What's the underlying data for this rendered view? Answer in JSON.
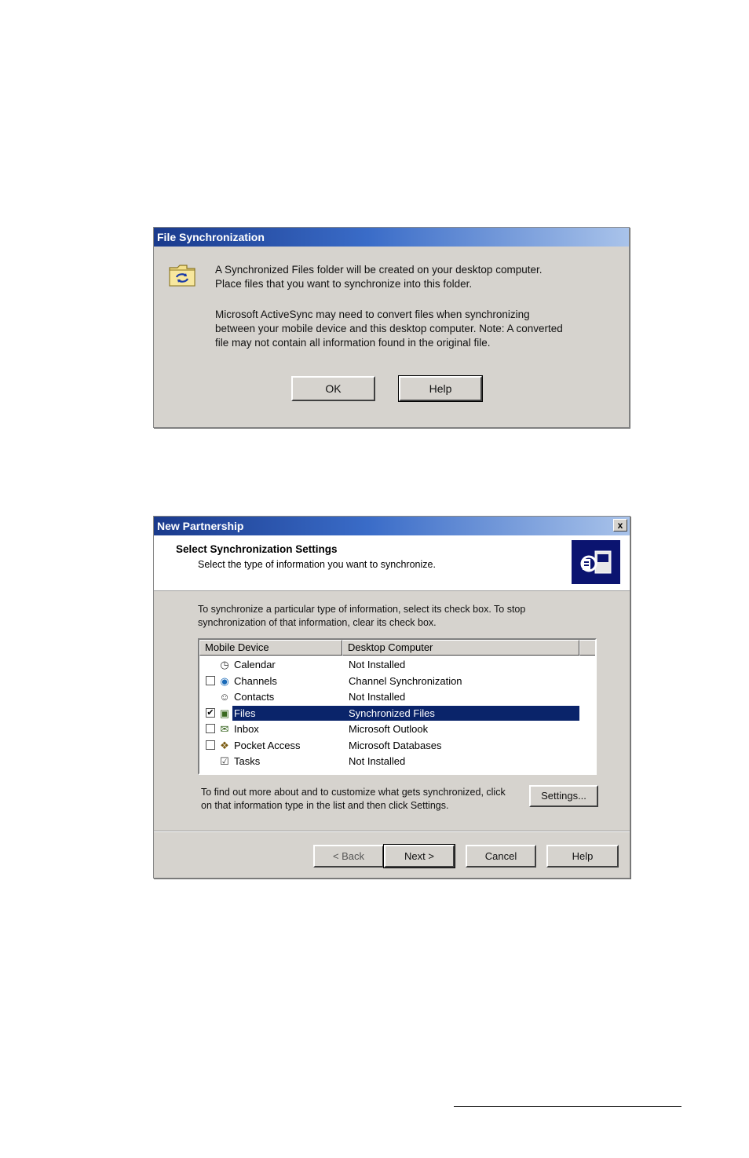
{
  "file_sync_dialog": {
    "title": "File Synchronization",
    "message_line1": "A Synchronized Files folder will be created on your desktop computer.",
    "message_line2": "Place files that you want to synchronize into this folder.",
    "message_line3": "Microsoft ActiveSync may need to convert files when synchronizing",
    "message_line4": "between your mobile device and this desktop computer.  Note: A converted",
    "message_line5": "file may not contain all information found in the original file.",
    "ok_label": "OK",
    "help_label": "Help"
  },
  "partnership_dialog": {
    "title": "New Partnership",
    "close_label": "x",
    "heading": "Select Synchronization Settings",
    "subheading": "Select the type of information you want to synchronize.",
    "instructions_line1": "To synchronize a particular type of information, select its check box. To stop",
    "instructions_line2": "synchronization of that information, clear its check box.",
    "columns": {
      "mobile": "Mobile Device",
      "desktop": "Desktop Computer"
    },
    "rows": [
      {
        "name": "Calendar",
        "desktop": "Not Installed",
        "checkbox": false,
        "checked": false,
        "selected": false,
        "icon": "calendar-icon"
      },
      {
        "name": "Channels",
        "desktop": "Channel Synchronization",
        "checkbox": true,
        "checked": false,
        "selected": false,
        "icon": "channels-icon"
      },
      {
        "name": "Contacts",
        "desktop": "Not Installed",
        "checkbox": false,
        "checked": false,
        "selected": false,
        "icon": "contacts-icon"
      },
      {
        "name": "Files",
        "desktop": "Synchronized Files",
        "checkbox": true,
        "checked": true,
        "selected": true,
        "icon": "files-icon"
      },
      {
        "name": "Inbox",
        "desktop": "Microsoft Outlook",
        "checkbox": true,
        "checked": false,
        "selected": false,
        "icon": "inbox-icon"
      },
      {
        "name": "Pocket Access",
        "desktop": "Microsoft Databases",
        "checkbox": true,
        "checked": false,
        "selected": false,
        "icon": "pocket-access-icon"
      },
      {
        "name": "Tasks",
        "desktop": "Not Installed",
        "checkbox": false,
        "checked": false,
        "selected": false,
        "icon": "tasks-icon"
      }
    ],
    "footer_line1": "To find out more about and to customize what gets synchronized, click",
    "footer_line2": "on that information type in the list and then click Settings.",
    "settings_label": "Settings...",
    "back_label": "< Back",
    "next_label": "Next >",
    "cancel_label": "Cancel",
    "help_label": "Help"
  },
  "colors": {
    "selection": "#0a246a",
    "dialog_face": "#d6d3ce",
    "title_start": "#1a3a8c"
  }
}
